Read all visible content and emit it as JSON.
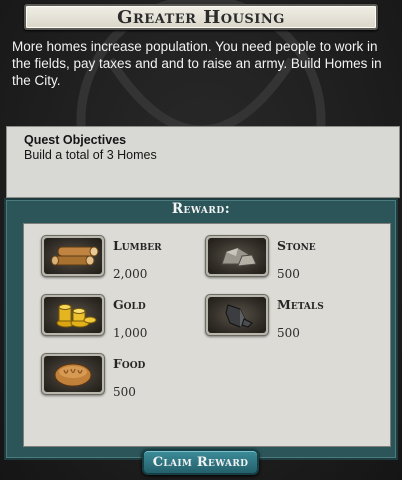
{
  "quest": {
    "title": "Greater Housing",
    "description": "More homes increase population. You need people to work in the fields, pay taxes and and to raise an army. Build Homes in the City."
  },
  "objectives": {
    "heading": "Quest Objectives",
    "items": [
      "Build  a total of 3 Homes"
    ]
  },
  "reward": {
    "title": "Reward:",
    "items": [
      {
        "name": "Lumber",
        "amount": "2,000",
        "icon": "lumber-icon"
      },
      {
        "name": "Stone",
        "amount": "500",
        "icon": "stone-icon"
      },
      {
        "name": "Gold",
        "amount": "1,000",
        "icon": "gold-icon"
      },
      {
        "name": "Metals",
        "amount": "500",
        "icon": "metals-icon"
      },
      {
        "name": "Food",
        "amount": "500",
        "icon": "food-icon"
      }
    ]
  },
  "claim_button": {
    "label": "Claim Reward"
  },
  "colors": {
    "reward_panel": "#2c5559",
    "claim_button": "#2f7884",
    "objectives_bg": "#d8d8d4"
  }
}
